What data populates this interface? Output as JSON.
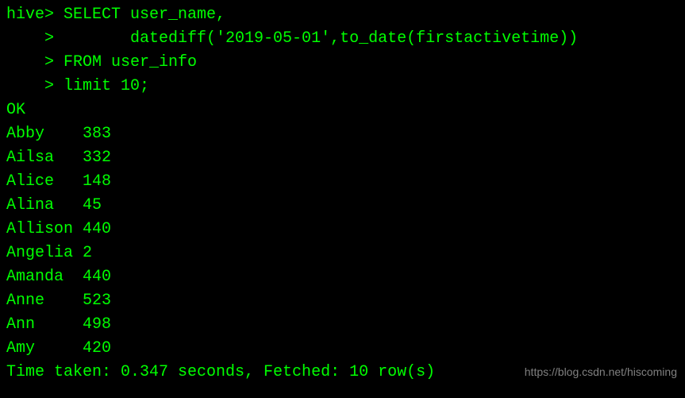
{
  "terminal": {
    "prompt": "hive>",
    "continuation": "    >",
    "query_lines": [
      "hive> SELECT user_name,",
      "    >        datediff('2019-05-01',to_date(firstactivetime))",
      "    > FROM user_info",
      "    > limit 10;"
    ],
    "status_ok": "OK",
    "results": [
      {
        "name": "Abby",
        "value": "383"
      },
      {
        "name": "Ailsa",
        "value": "332"
      },
      {
        "name": "Alice",
        "value": "148"
      },
      {
        "name": "Alina",
        "value": "45"
      },
      {
        "name": "Allison",
        "value": "440"
      },
      {
        "name": "Angelia",
        "value": "2"
      },
      {
        "name": "Amanda",
        "value": "440"
      },
      {
        "name": "Anne",
        "value": "523"
      },
      {
        "name": "Ann",
        "value": "498"
      },
      {
        "name": "Amy",
        "value": "420"
      }
    ],
    "result_col_width": 8,
    "timing": "Time taken: 0.347 seconds, Fetched: 10 row(s)"
  },
  "watermark": "https://blog.csdn.net/hiscoming"
}
